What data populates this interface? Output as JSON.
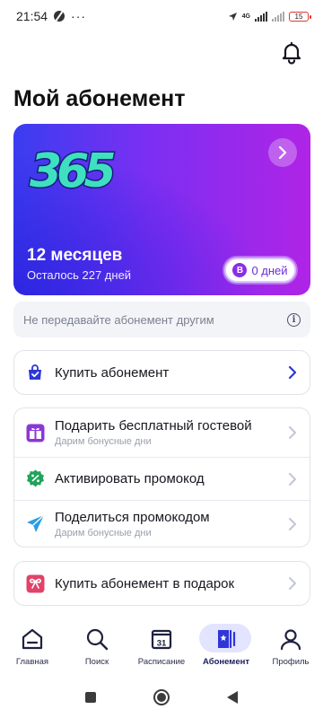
{
  "status_bar": {
    "time": "21:54",
    "more": "···",
    "network": "4G",
    "battery": "15"
  },
  "page": {
    "title": "Мой абонемент"
  },
  "card": {
    "logo_text": "365",
    "duration": "12 месяцев",
    "remaining": "Осталось 227 дней",
    "bonus_badge": "В",
    "bonus_days": "0 дней",
    "colors": {
      "from": "#3a3df0",
      "to": "#b024e6",
      "logo": "#3ee0c0"
    }
  },
  "notice": {
    "text": "Не передавайте абонемент другим",
    "info_glyph": "i"
  },
  "buy": {
    "title": "Купить абонемент"
  },
  "actions": [
    {
      "title": "Подарить бесплатный гостевой",
      "subtitle": "Дарим бонусные дни",
      "icon": "gift-icon"
    },
    {
      "title": "Активировать промокод",
      "subtitle": "",
      "icon": "percent-badge-icon"
    },
    {
      "title": "Поделиться промокодом",
      "subtitle": "Дарим бонусные дни",
      "icon": "send-icon"
    }
  ],
  "gift": {
    "title": "Купить абонемент в подарок"
  },
  "nav": {
    "items": [
      {
        "label": "Главная",
        "icon": "home-icon"
      },
      {
        "label": "Поиск",
        "icon": "search-icon"
      },
      {
        "label": "Расписание",
        "icon": "calendar-icon",
        "day": "31"
      },
      {
        "label": "Абонемент",
        "icon": "subscription-icon",
        "active": true
      },
      {
        "label": "Профиль",
        "icon": "profile-icon"
      }
    ]
  },
  "accent": "#2f36d8"
}
